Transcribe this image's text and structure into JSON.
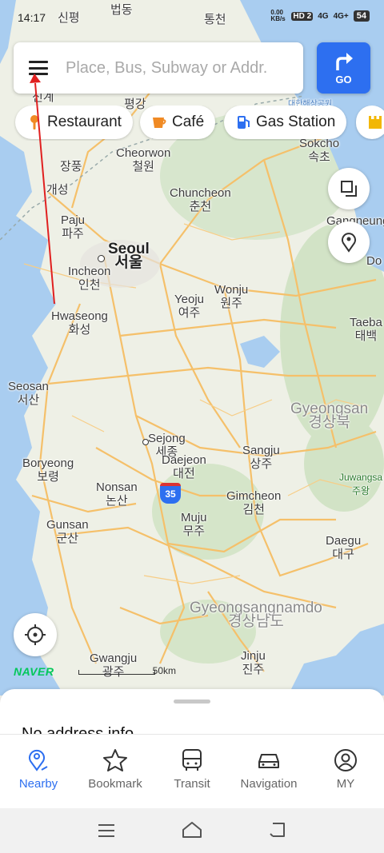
{
  "status_bar": {
    "time": "14:17",
    "net_speed": "0.00 KB/s",
    "hd": "HD 2",
    "signal1": "4G",
    "signal2": "4G+",
    "battery": "54"
  },
  "search": {
    "placeholder": "Place, Bus, Subway or Addr."
  },
  "go_button": {
    "label": "GO"
  },
  "categories": [
    {
      "label": "Restaurant",
      "icon": "fork-icon",
      "color": "#f08a24"
    },
    {
      "label": "Café",
      "icon": "cup-icon",
      "color": "#f08a24"
    },
    {
      "label": "Gas Station",
      "icon": "fuel-icon",
      "color": "#2d6ff0"
    }
  ],
  "map": {
    "places": [
      {
        "en": "법동",
        "ko": ""
      },
      {
        "en": "통천",
        "ko": ""
      },
      {
        "en": "신평",
        "ko": ""
      },
      {
        "en": "평강",
        "ko": ""
      },
      {
        "en": "신계",
        "ko": ""
      },
      {
        "en": "Sokcho",
        "ko": "속초"
      },
      {
        "en": "Cheorwon",
        "ko": "철원"
      },
      {
        "en": "장풍",
        "ko": ""
      },
      {
        "en": "개성",
        "ko": ""
      },
      {
        "en": "Chuncheon",
        "ko": "춘천"
      },
      {
        "en": "Paju",
        "ko": "파주"
      },
      {
        "en": "Gangneung",
        "ko": ""
      },
      {
        "en": "Seoul",
        "ko": "서울"
      },
      {
        "en": "Incheon",
        "ko": "인천"
      },
      {
        "en": "Wonju",
        "ko": "원주"
      },
      {
        "en": "Yeoju",
        "ko": "여주"
      },
      {
        "en": "Hwaseong",
        "ko": "화성"
      },
      {
        "en": "Taeba",
        "ko": "태백"
      },
      {
        "en": "Seosan",
        "ko": "서산"
      },
      {
        "en": "Gyeongsan",
        "ko": "경상북"
      },
      {
        "en": "Sejong",
        "ko": "세종"
      },
      {
        "en": "Daejeon",
        "ko": "대전"
      },
      {
        "en": "Sangju",
        "ko": "상주"
      },
      {
        "en": "Boryeong",
        "ko": "보령"
      },
      {
        "en": "Juwangsa",
        "ko": "주왕"
      },
      {
        "en": "Nonsan",
        "ko": "논산"
      },
      {
        "en": "Gimcheon",
        "ko": "김천"
      },
      {
        "en": "Muju",
        "ko": "무주"
      },
      {
        "en": "Gunsan",
        "ko": "군산"
      },
      {
        "en": "Daegu",
        "ko": "대구"
      },
      {
        "en": "Gyeongsangnamdo",
        "ko": "경상남도"
      },
      {
        "en": "Gwangju",
        "ko": "광주"
      },
      {
        "en": "Jinju",
        "ko": "진주"
      },
      {
        "en": "Do",
        "ko": ""
      },
      {
        "en": "대한해상공원",
        "ko": ""
      }
    ],
    "highway_shield": "35",
    "scale_label": "50km",
    "brand": "NAVER"
  },
  "sheet": {
    "address_text": "No address info"
  },
  "tabs": [
    {
      "label": "Nearby",
      "icon": "nearby-pin-icon",
      "active": true
    },
    {
      "label": "Bookmark",
      "icon": "star-icon",
      "active": false
    },
    {
      "label": "Transit",
      "icon": "bus-icon",
      "active": false
    },
    {
      "label": "Navigation",
      "icon": "car-icon",
      "active": false
    },
    {
      "label": "MY",
      "icon": "user-icon",
      "active": false
    }
  ],
  "colors": {
    "accent": "#2d6ff0",
    "naver_green": "#03c75a",
    "road": "#f5c06a",
    "sea": "#a9cdf0"
  }
}
